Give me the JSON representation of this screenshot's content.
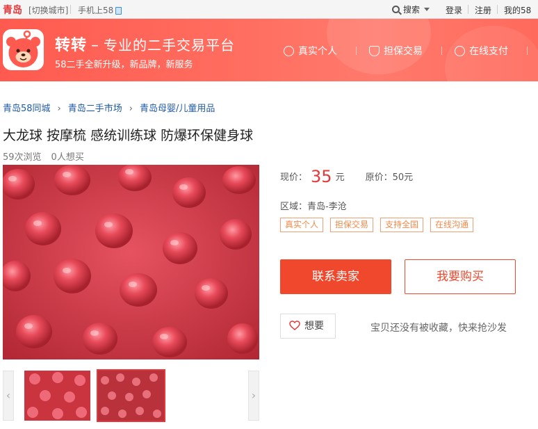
{
  "topbar": {
    "city": "青岛",
    "switch_city": "[切换城市]",
    "mobile": "手机上58",
    "search": "搜索",
    "login": "登录",
    "register": "注册",
    "my58": "我的58"
  },
  "banner": {
    "brand": "转转",
    "dash": "–",
    "brand_sub": "专业的二手交易平台",
    "slogan": "58二手全新升级，新品牌，新服务",
    "features": [
      {
        "label": "真实个人",
        "icon": "person-verified-icon"
      },
      {
        "label": "担保交易",
        "icon": "shield-icon"
      },
      {
        "label": "在线支付",
        "icon": "yen-icon"
      }
    ]
  },
  "breadcrumb": [
    "青岛58同城",
    "青岛二手市场",
    "青岛母婴/儿童用品"
  ],
  "product": {
    "title": "大龙球 按摩梳 感统训练球 防爆环保健身球",
    "views": "59次浏览",
    "wants": "0人想买",
    "price_label": "现价：",
    "price": "35",
    "price_unit": "元",
    "original_price": "原价：50元",
    "region": "区域：青岛-李沧",
    "tags": [
      "真实个人",
      "担保交易",
      "支持全国",
      "在线沟通"
    ]
  },
  "actions": {
    "contact": "联系卖家",
    "buy": "我要购买",
    "want": "想要",
    "fav_note": "宝贝还没有被收藏，快来抢沙发"
  },
  "thumbs": {
    "prev": "‹",
    "next": "›"
  },
  "colors": {
    "accent": "#f0482d",
    "price": "#e4393c",
    "link": "#1e5aa8",
    "banner": "#ff6a5c",
    "tag": "#f08a4b"
  }
}
